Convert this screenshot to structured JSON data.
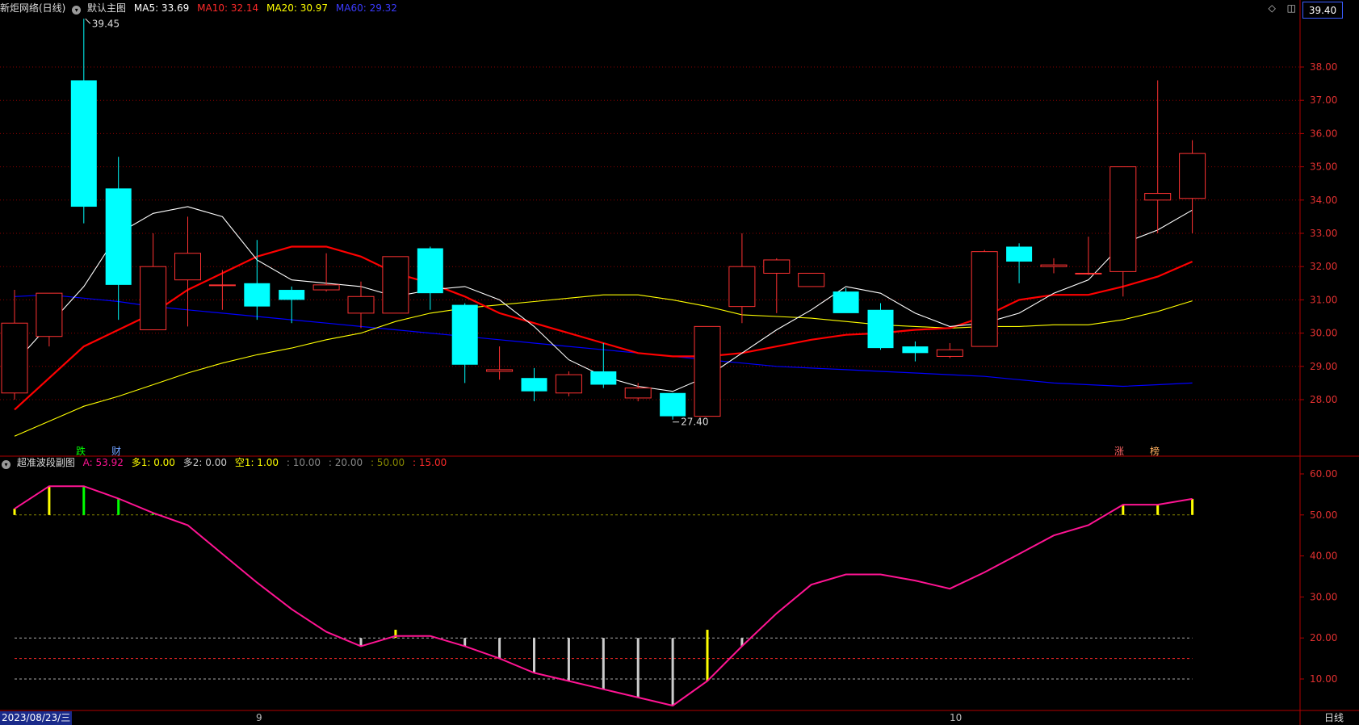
{
  "main_header": {
    "stock_name": "新炬网络(日线)",
    "chart_name": "默认主图",
    "ma5": "MA5: 33.69",
    "ma10": "MA10: 32.14",
    "ma20": "MA20: 30.97",
    "ma60": "MA60: 29.32"
  },
  "ticker_price": "39.40",
  "top_icons": [
    "diamond-icon",
    "window-icon"
  ],
  "sub_header": {
    "chart_name": "超准波段副图",
    "a": "A: 53.92",
    "duo1": "多1: 0.00",
    "duo2": "多2: 0.00",
    "kong1": "空1: 1.00",
    "l10": ": 10.00",
    "l20": ": 20.00",
    "l50": ": 50.00",
    "l15": ": 15.00"
  },
  "signals": {
    "die": "跌",
    "cai": "财",
    "zhang": "涨",
    "bang": "榜"
  },
  "bottom_bar": {
    "date": "2023/08/23/三",
    "month9": "9",
    "month10": "10",
    "period": "日线"
  },
  "colors": {
    "up": "#ff3232",
    "down": "#00ffff",
    "ma5": "#ffffff",
    "ma10": "#ff0000",
    "ma20": "#ffff00",
    "ma60": "#0000ff",
    "osc": "#ff1493",
    "grid": "#8b0000"
  },
  "chart_data": [
    {
      "type": "candlestick",
      "title": "新炬网络(日线)",
      "y_ticks": [
        "38.00",
        "37.00",
        "36.00",
        "35.00",
        "34.00",
        "33.00",
        "32.00",
        "31.00",
        "30.00",
        "29.00",
        "28.00"
      ],
      "ylim": [
        26.6,
        40.0
      ],
      "max_label": "39.45",
      "min_label": "27.40",
      "ohlc": [
        [
          28.2,
          31.3,
          28.0,
          30.3
        ],
        [
          29.9,
          31.1,
          29.6,
          31.2
        ],
        [
          37.6,
          39.45,
          33.3,
          33.8
        ],
        [
          34.35,
          35.3,
          30.4,
          31.45
        ],
        [
          30.1,
          33.0,
          30.1,
          32.0
        ],
        [
          31.6,
          33.5,
          30.2,
          32.4
        ],
        [
          31.45,
          31.9,
          30.7,
          31.45
        ],
        [
          31.5,
          32.8,
          30.4,
          30.8
        ],
        [
          31.3,
          31.4,
          30.3,
          31.0
        ],
        [
          31.3,
          32.4,
          31.25,
          31.45
        ],
        [
          30.6,
          31.55,
          30.15,
          31.1
        ],
        [
          30.6,
          32.3,
          30.6,
          32.3
        ],
        [
          32.55,
          32.6,
          30.7,
          31.2
        ],
        [
          30.85,
          30.9,
          28.5,
          29.05
        ],
        [
          28.85,
          29.6,
          28.6,
          28.9
        ],
        [
          28.65,
          28.95,
          27.95,
          28.25
        ],
        [
          28.2,
          28.85,
          28.1,
          28.75
        ],
        [
          28.85,
          29.7,
          28.35,
          28.45
        ],
        [
          28.05,
          28.5,
          27.95,
          28.35
        ],
        [
          28.2,
          28.2,
          27.4,
          27.5
        ],
        [
          27.5,
          30.2,
          27.5,
          30.2
        ],
        [
          30.8,
          33.0,
          30.3,
          32.0
        ],
        [
          31.8,
          32.25,
          30.6,
          32.2
        ],
        [
          31.4,
          31.8,
          31.4,
          31.8
        ],
        [
          31.25,
          31.35,
          30.65,
          30.6
        ],
        [
          30.7,
          30.9,
          29.5,
          29.55
        ],
        [
          29.6,
          29.75,
          29.15,
          29.4
        ],
        [
          29.3,
          29.7,
          29.25,
          29.5
        ],
        [
          29.6,
          32.5,
          29.6,
          32.45
        ],
        [
          32.6,
          32.7,
          31.5,
          32.15
        ],
        [
          32.0,
          32.25,
          31.8,
          32.05
        ],
        [
          31.8,
          32.9,
          31.75,
          31.8
        ],
        [
          31.85,
          35.0,
          31.1,
          35.0
        ],
        [
          34.0,
          37.6,
          33.0,
          34.2
        ],
        [
          34.05,
          35.8,
          33.0,
          35.4
        ]
      ],
      "ma5": [
        29.1,
        null,
        31.4,
        33.0,
        33.6,
        33.8,
        33.5,
        32.2,
        31.6,
        31.5,
        31.4,
        31.1,
        31.3,
        31.4,
        31.0,
        30.2,
        29.2,
        28.7,
        28.4,
        28.25,
        28.7,
        29.4,
        30.1,
        30.7,
        31.4,
        31.2,
        30.6,
        30.2,
        30.3,
        30.6,
        31.2,
        31.6,
        32.7,
        33.1,
        33.7
      ],
      "ma10": [
        27.7,
        null,
        29.6,
        30.1,
        30.6,
        31.3,
        31.8,
        32.3,
        32.6,
        32.6,
        32.3,
        31.8,
        31.5,
        31.1,
        30.6,
        30.3,
        30.0,
        29.7,
        29.4,
        29.3,
        29.3,
        29.4,
        29.6,
        29.8,
        29.95,
        30.0,
        30.1,
        30.15,
        30.5,
        31.0,
        31.15,
        31.15,
        31.4,
        31.7,
        32.15
      ],
      "ma20": [
        26.9,
        null,
        27.8,
        28.1,
        28.45,
        28.8,
        29.1,
        29.35,
        29.55,
        29.8,
        30.0,
        30.35,
        30.6,
        30.75,
        30.85,
        30.95,
        31.05,
        31.15,
        31.15,
        31.0,
        30.8,
        30.55,
        30.5,
        30.45,
        30.35,
        30.25,
        30.2,
        30.15,
        30.2,
        30.2,
        30.25,
        30.25,
        30.4,
        30.65,
        30.97
      ],
      "ma60": [
        31.1,
        31.15,
        31.05,
        30.95,
        30.8,
        30.7,
        30.6,
        30.5,
        30.4,
        30.3,
        30.2,
        30.1,
        30.0,
        29.9,
        29.8,
        29.7,
        29.6,
        29.5,
        29.4,
        29.3,
        29.2,
        29.1,
        29.0,
        28.95,
        28.9,
        28.85,
        28.8,
        28.75,
        28.7,
        28.6,
        28.5,
        28.45,
        28.4,
        28.45,
        28.5
      ]
    },
    {
      "type": "line",
      "title": "超准波段副图",
      "y_ticks": [
        "60.00",
        "50.00",
        "40.00",
        "30.00",
        "20.00",
        "10.00"
      ],
      "ylim": [
        0,
        62
      ],
      "ref_lines": [
        50,
        20,
        15,
        10
      ],
      "a": [
        51.5,
        57,
        57,
        54,
        50.5,
        47.5,
        40.5,
        33.5,
        27,
        21.5,
        18,
        20.5,
        20.5,
        18,
        15,
        11.5,
        9.5,
        7.5,
        5.5,
        3.5,
        9.5,
        18,
        26,
        33,
        35.5,
        35.5,
        34,
        32,
        36,
        40.5,
        45,
        47.5,
        52.5,
        52.5,
        53.92
      ],
      "bars": [
        {
          "i": 0,
          "color": "#ffff00",
          "lo": 50,
          "hi": 51.5
        },
        {
          "i": 1,
          "color": "#ffff00",
          "lo": 50,
          "hi": 57
        },
        {
          "i": 2,
          "color": "#00ff00",
          "lo": 50,
          "hi": 57
        },
        {
          "i": 3,
          "color": "#00ff00",
          "lo": 50,
          "hi": 54
        },
        {
          "i": 4,
          "color": "#00ff00",
          "lo": 50,
          "hi": 50.5
        },
        {
          "i": 10,
          "color": "#cccccc",
          "lo": 18,
          "hi": 20
        },
        {
          "i": 11,
          "color": "#ffff00",
          "lo": 20,
          "hi": 22
        },
        {
          "i": 13,
          "color": "#cccccc",
          "lo": 18,
          "hi": 20
        },
        {
          "i": 14,
          "color": "#cccccc",
          "lo": 15,
          "hi": 20
        },
        {
          "i": 15,
          "color": "#cccccc",
          "lo": 11.5,
          "hi": 20
        },
        {
          "i": 16,
          "color": "#cccccc",
          "lo": 9.5,
          "hi": 20
        },
        {
          "i": 17,
          "color": "#cccccc",
          "lo": 7.5,
          "hi": 20
        },
        {
          "i": 18,
          "color": "#cccccc",
          "lo": 5.5,
          "hi": 20
        },
        {
          "i": 19,
          "color": "#cccccc",
          "lo": 3.5,
          "hi": 20
        },
        {
          "i": 20,
          "color": "#ffff00",
          "lo": 9.5,
          "hi": 22
        },
        {
          "i": 21,
          "color": "#cccccc",
          "lo": 18,
          "hi": 20
        },
        {
          "i": 32,
          "color": "#ffff00",
          "lo": 50,
          "hi": 52.5
        },
        {
          "i": 33,
          "color": "#ffff00",
          "lo": 50,
          "hi": 52.5
        },
        {
          "i": 34,
          "color": "#ffff00",
          "lo": 50,
          "hi": 53.92
        }
      ]
    }
  ]
}
